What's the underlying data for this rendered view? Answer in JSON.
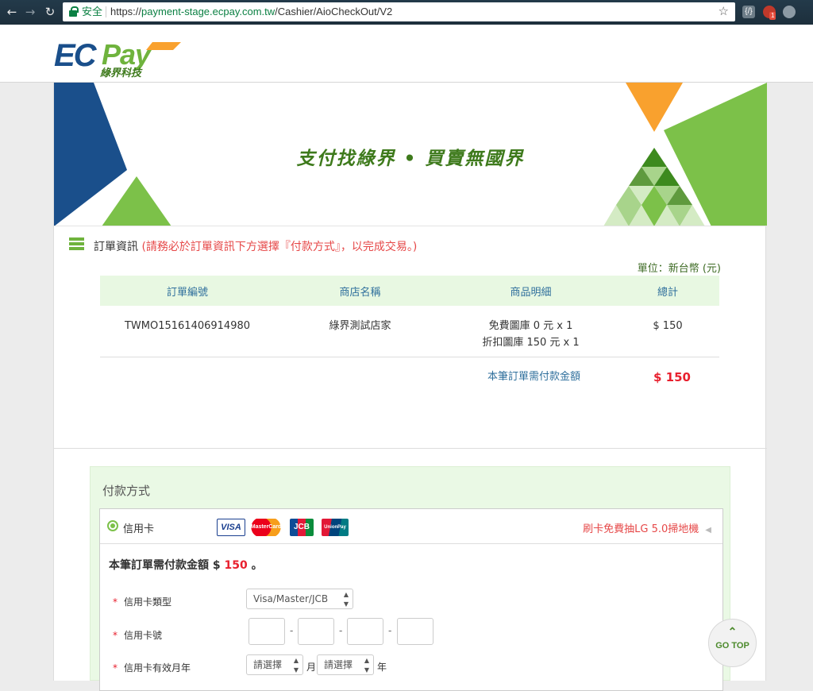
{
  "browser": {
    "secure_label": "安全",
    "url_scheme": "https://",
    "url_host": "payment-stage.ecpay.com.tw",
    "url_path": "/Cashier/AioCheckOut/V2",
    "ext_badge": "1"
  },
  "header": {
    "logo_text": "ECPay",
    "logo_sub": "綠界科技"
  },
  "banner": {
    "slogan": "支付找綠界 • 買賣無國界"
  },
  "order": {
    "title": "訂單資訊",
    "note": "(請務必於訂單資訊下方選擇『付款方式』，以完成交易。)",
    "unit": "單位：新台幣 (元)",
    "columns": [
      "訂單編號",
      "商店名稱",
      "商品明細",
      "總計"
    ],
    "row": {
      "order_no": "TWMO15161406914980",
      "store": "綠界測試店家",
      "item1": "免費圖庫 0 元 x 1",
      "item2": "折扣圖庫 150 元 x 1",
      "total": "$ 150"
    },
    "total_label": "本筆訂單需付款金額",
    "total_value": "$ 150"
  },
  "payment": {
    "title": "付款方式",
    "method_name": "信用卡",
    "card_logos": [
      "VISA",
      "MasterCard",
      "JCB",
      "UnionPay"
    ],
    "promo": "刷卡免費抽LG 5.0掃地機",
    "amount_prefix": "本筆訂單需付款金額",
    "amount_currency": "$",
    "amount_value": "150",
    "amount_suffix": "。",
    "fields": {
      "card_type_label": "信用卡類型",
      "card_type_value": "Visa/Master/JCB",
      "card_no_label": "信用卡號",
      "expiry_label": "信用卡有效月年",
      "month_placeholder": "請選擇",
      "month_unit": "月",
      "year_placeholder": "請選擇",
      "year_unit": "年"
    }
  },
  "gotop": {
    "label": "GO TOP"
  },
  "colors": {
    "brand_green": "#6fb33d",
    "brand_blue": "#1a4f8b",
    "accent_orange": "#f9a12e",
    "alert_red": "#e8202e"
  }
}
